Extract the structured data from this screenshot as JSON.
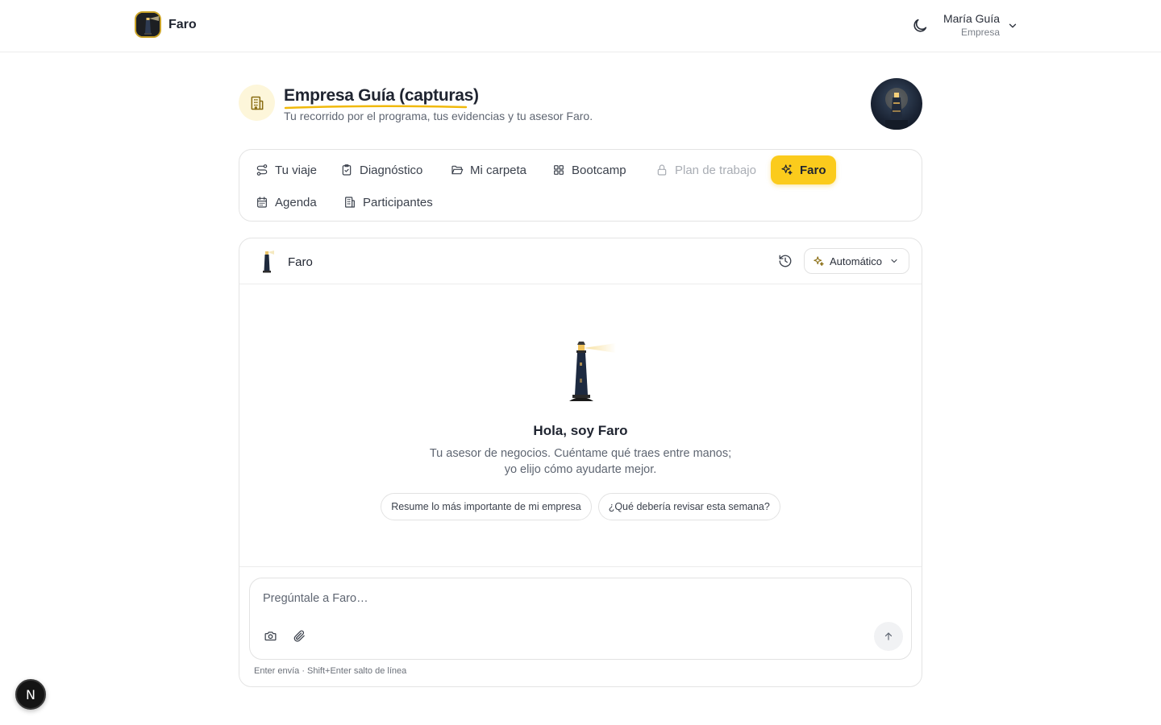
{
  "app": {
    "name": "Faro"
  },
  "user": {
    "name": "María Guía",
    "role": "Empresa"
  },
  "company": {
    "title": "Empresa Guía (capturas)",
    "subtitle": "Tu recorrido por el programa, tus evidencias y tu asesor Faro."
  },
  "tabs": [
    {
      "label": "Tu viaje",
      "icon": "route-icon",
      "state": "normal"
    },
    {
      "label": "Diagnóstico",
      "icon": "clipboard-check-icon",
      "state": "normal"
    },
    {
      "label": "Mi carpeta",
      "icon": "folder-open-icon",
      "state": "normal"
    },
    {
      "label": "Bootcamp",
      "icon": "grid-icon",
      "state": "normal"
    },
    {
      "label": "Plan de trabajo",
      "icon": "lock-icon",
      "state": "disabled"
    },
    {
      "label": "Faro",
      "icon": "sparkles-icon",
      "state": "active"
    },
    {
      "label": "Agenda",
      "icon": "calendar-icon",
      "state": "normal"
    },
    {
      "label": "Participantes",
      "icon": "building-icon",
      "state": "normal"
    }
  ],
  "chat": {
    "header_title": "Faro",
    "mode_label": "Automático",
    "greeting": "Hola, soy Faro",
    "intro_line1": "Tu asesor de negocios. Cuéntame qué traes entre manos;",
    "intro_line2": "yo elijo cómo ayudarte mejor.",
    "suggestions": [
      "Resume lo más importante de mi empresa",
      "¿Qué debería revisar esta semana?"
    ],
    "input_placeholder": "Pregúntale a Faro…",
    "hint": "Enter envía · Shift+Enter salto de línea"
  },
  "dev_badge": "N",
  "colors": {
    "accent": "#fbcb1c",
    "accent_soft": "#fdf6da",
    "text": "#1f2430",
    "muted": "#5f6672",
    "border": "#e4e4e4"
  }
}
